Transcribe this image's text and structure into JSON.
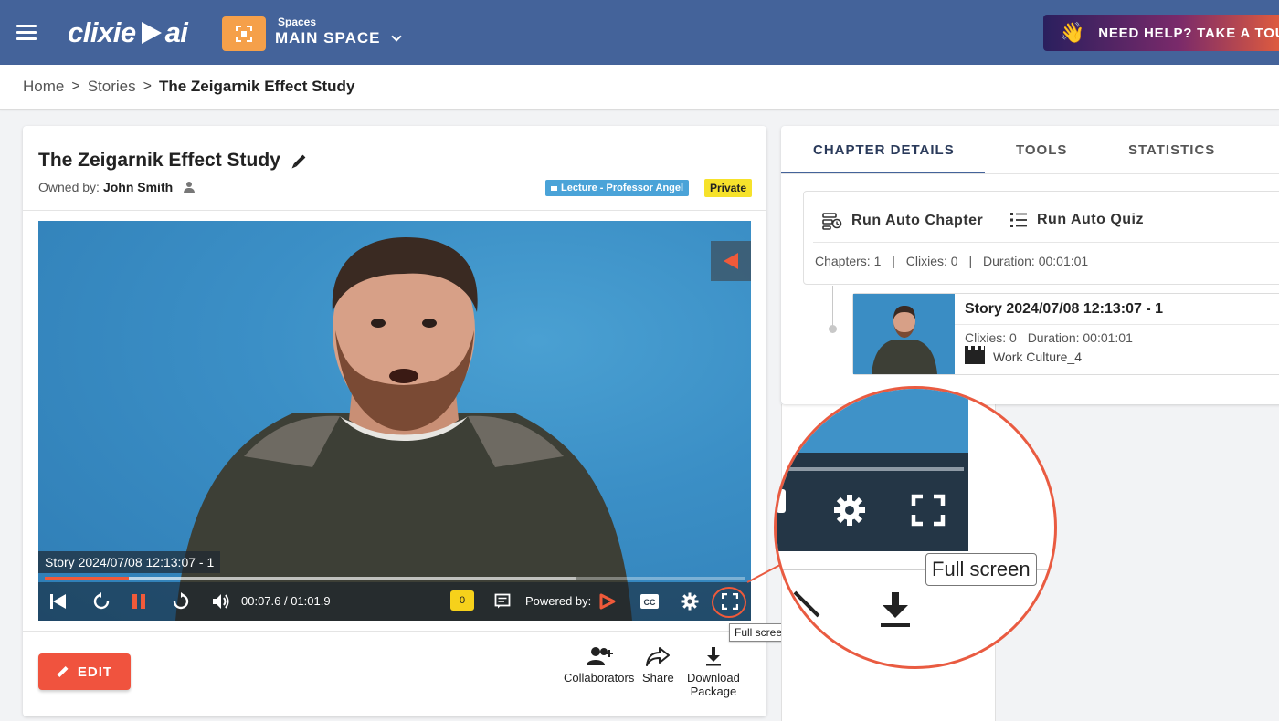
{
  "header": {
    "brand": "clixie",
    "brand_suffix": "ai",
    "spaces_label": "Spaces",
    "space_name": "MAIN SPACE",
    "help_text": "NEED HELP? TAKE A TOUR"
  },
  "breadcrumb": {
    "home": "Home",
    "stories": "Stories",
    "current": "The Zeigarnik Effect Study",
    "sep": ">"
  },
  "story": {
    "title": "The Zeigarnik Effect Study",
    "owned_label": "Owned by:",
    "owner": "John Smith",
    "folder_tag": "Lecture - Professor Angel",
    "privacy_tag": "Private"
  },
  "player": {
    "caption": "Story 2024/07/08 12:13:07 - 1",
    "current_time": "00:07.6",
    "total_time": "01:01.9",
    "time_text": "00:07.6 / 01:01.9",
    "clixie_count": "0",
    "powered_by": "Powered by:",
    "tooltip": "Full screen",
    "progress_fraction": 0.12,
    "buffered_fraction": 0.76
  },
  "actions": {
    "edit": "EDIT",
    "collaborators": "Collaborators",
    "share": "Share",
    "download_line1": "Download",
    "download_line2": "Package"
  },
  "tabs": [
    "CHAPTER DETAILS",
    "TOOLS",
    "STATISTICS"
  ],
  "chapter_tools": {
    "auto_chapter": "Run Auto Chapter",
    "auto_quiz": "Run Auto Quiz",
    "chapters": "Chapters: 1",
    "clixies": "Clixies: 0",
    "duration": "Duration: 00:01:01",
    "pipe": "|"
  },
  "chapter": {
    "title": "Story 2024/07/08 12:13:07 - 1",
    "clixies": "Clixies: 0",
    "duration": "Duration: 00:01:01",
    "folder": "Work Culture_4"
  },
  "zoom": {
    "tooltip": "Full screen"
  },
  "colors": {
    "header_bg": "#44639a",
    "accent": "#f0533e",
    "space_icon": "#f5a04a",
    "folder_tag": "#4aa3d8",
    "private_tag": "#f6e22b"
  }
}
